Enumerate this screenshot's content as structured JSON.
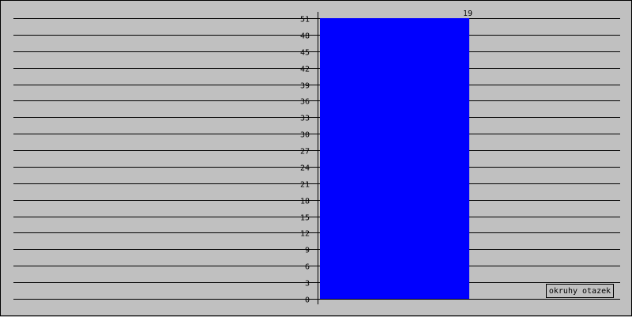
{
  "chart_data": {
    "type": "bar",
    "title": "",
    "xlabel": "",
    "ylabel": "",
    "ylim": [
      0,
      51
    ],
    "yticks": [
      0,
      3,
      6,
      9,
      12,
      15,
      18,
      21,
      24,
      27,
      30,
      33,
      36,
      39,
      42,
      45,
      48,
      51
    ],
    "grid": true,
    "legend_position": "bottom-right",
    "series": [
      {
        "name": "okruhy otazek",
        "values": [
          51
        ],
        "data_labels": [
          "19"
        ],
        "color": "#0000ff"
      }
    ]
  }
}
